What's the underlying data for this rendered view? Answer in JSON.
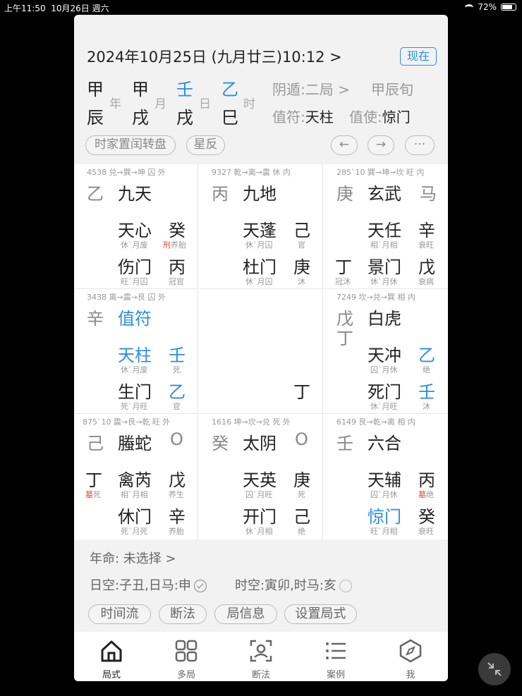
{
  "status_bar": {
    "time": "上午11:50",
    "date": "10月26日 週六",
    "battery": "72%"
  },
  "header": {
    "datetime": "2024年10月25日 (九月廿三)10:12 >",
    "now_button": "现在",
    "ganzhi": {
      "year_stem": "甲",
      "year_branch": "辰",
      "year_label": "年",
      "month_stem": "甲",
      "month_branch": "戌",
      "month_label": "月",
      "day_stem": "壬",
      "day_branch": "戌",
      "day_label": "日",
      "hour_stem": "乙",
      "hour_branch": "巳",
      "hour_label": "时"
    },
    "dun": "阴遁:二局 >",
    "xun": "甲辰旬",
    "zhifu_label": "值符:",
    "zhifu_value": "天柱",
    "zhishi_label": "值使:",
    "zhishi_value": "惊门",
    "pills": {
      "transfer": "时家置闰转盘",
      "star": "星反",
      "prev": "←",
      "next": "→",
      "more": "···"
    }
  },
  "palaces": [
    {
      "info": "4538 兑→巽→坤 囚 外",
      "tianpan": "乙",
      "god": "九天",
      "star": "天心",
      "star_stem": "癸",
      "star_state_pre": "休`月废",
      "star_stem_state_red": "刑",
      "star_stem_state": "养胎",
      "door": "伤门",
      "door_stem": "丙",
      "door_state": "旺`月囚",
      "door_stem_state": "冠官"
    },
    {
      "info": "9327 乾→离→震 休 内",
      "tianpan": "丙",
      "god": "九地",
      "star": "天蓬",
      "star_stem": "己",
      "star_state_pre": "休`月囚",
      "star_stem_state": "官",
      "door": "杜门",
      "door_stem": "庚",
      "door_state": "休`月囚",
      "door_stem_state": "沐"
    },
    {
      "info": "285`10 巽→坤→坎 旺 内",
      "tianpan": "庚",
      "god": "玄武",
      "horse": "马",
      "star": "天任",
      "star_stem": "辛",
      "star_state_pre": "相`月相",
      "star_stem_state": "衰旺",
      "left_stem": "丁",
      "left_state": "冠沐",
      "door": "景门",
      "door_stem": "戊",
      "door_state": "休`月休",
      "door_stem_state": "衰病"
    },
    {
      "info": "3438 离→震→艮 囚 外",
      "tianpan": "辛",
      "god": "值符",
      "star": "天柱",
      "star_stem": "壬",
      "star_state_pre": "休`月废",
      "star_stem_state": "死",
      "door": "生门",
      "door_stem": "乙",
      "door_state": "死`月旺",
      "door_stem_state": "官"
    },
    {
      "center_stem": "丁"
    },
    {
      "info": "7249 坎→兑→巽 相 内",
      "tianpan": "戊",
      "tianpan2": "丁",
      "god": "白虎",
      "star": "天冲",
      "star_stem": "乙",
      "star_state_pre": "囚`月休",
      "star_stem_state": "绝",
      "door": "死门",
      "door_stem": "壬",
      "door_state": "休`月旺",
      "door_stem_state": "沐"
    },
    {
      "info": "875`10 震→艮→乾 旺 外",
      "tianpan": "己",
      "god": "螣蛇",
      "empty": "O",
      "star": "禽芮",
      "star_stem": "戊",
      "left_stem": "丁",
      "left_state_red": "墓",
      "left_state": "死",
      "star_state_pre": "相`月相",
      "star_stem_state": "养生",
      "door": "休门",
      "door_stem": "辛",
      "door_state": "死`月死",
      "door_stem_state": "养胎"
    },
    {
      "info": "1616 坤→坎→兑 死 外",
      "tianpan": "癸",
      "god": "太阴",
      "empty": "O",
      "star": "天英",
      "star_stem": "庚",
      "star_state_pre": "囚`月旺",
      "star_stem_state": "死",
      "door": "开门",
      "door_stem": "己",
      "door_state": "休`月相",
      "door_stem_state": "绝"
    },
    {
      "info": "6149 艮→乾→离 相 内",
      "tianpan": "壬",
      "god": "六合",
      "star": "天辅",
      "star_stem": "丙",
      "star_state_pre": "囚`月休",
      "star_stem_state_red": "墓",
      "star_stem_state": "绝",
      "door": "惊门",
      "door_stem": "癸",
      "door_state": "旺`月相",
      "door_stem_state": "衰旺"
    }
  ],
  "footer": {
    "nianming": "年命:  未选择 >",
    "rikong": "日空:子丑,日马:申",
    "shikong": "时空:寅卯,时马:亥",
    "buttons": [
      "时间流",
      "断法",
      "局信息",
      "设置局式"
    ]
  },
  "tabs": [
    {
      "label": "局式",
      "icon": "home-icon"
    },
    {
      "label": "多局",
      "icon": "grid-icon"
    },
    {
      "label": "断法",
      "icon": "scan-icon"
    },
    {
      "label": "案例",
      "icon": "list-icon"
    },
    {
      "label": "我",
      "icon": "compass-icon"
    }
  ],
  "colors": {
    "accent": "#2a8ee0",
    "red": "#e0463c"
  }
}
